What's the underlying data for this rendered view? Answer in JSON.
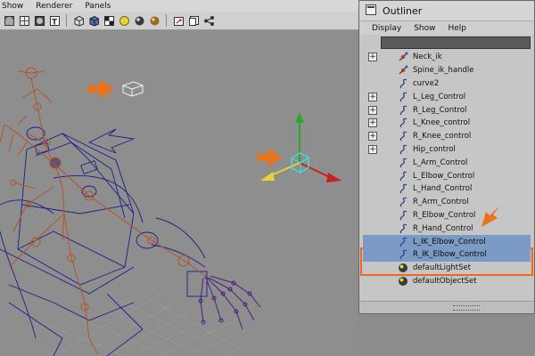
{
  "viewport": {
    "menu": [
      "Show",
      "Renderer",
      "Panels"
    ],
    "toolbar_icons": [
      "view-cube-icon",
      "wireframe-icon",
      "smooth-shade-icon",
      "textured-icon",
      "bounding-box-icon",
      "use-lights-icon",
      "shadows-icon",
      "ambient-occlusion-icon",
      "xray-icon",
      "isolate-icon",
      "camera-icon",
      "snapshot-icon"
    ]
  },
  "outliner": {
    "title": "Outliner",
    "menu": [
      "Display",
      "Show",
      "Help"
    ],
    "items": [
      {
        "label": "Neck_ik",
        "icon": "ik-handle-icon",
        "expandable": true,
        "selected": false
      },
      {
        "label": "Spine_ik_handle",
        "icon": "ik-handle-icon",
        "expandable": false,
        "selected": false
      },
      {
        "label": "curve2",
        "icon": "curve-icon",
        "expandable": false,
        "selected": false
      },
      {
        "label": "L_Leg_Control",
        "icon": "curve-icon",
        "expandable": true,
        "selected": false
      },
      {
        "label": "R_Leg_Control",
        "icon": "curve-icon",
        "expandable": true,
        "selected": false
      },
      {
        "label": "L_Knee_control",
        "icon": "curve-icon",
        "expandable": true,
        "selected": false
      },
      {
        "label": "R_Knee_control",
        "icon": "curve-icon",
        "expandable": true,
        "selected": false
      },
      {
        "label": "Hip_control",
        "icon": "curve-icon",
        "expandable": true,
        "selected": false
      },
      {
        "label": "L_Arm_Control",
        "icon": "curve-icon",
        "expandable": false,
        "selected": false
      },
      {
        "label": "L_Elbow_Control",
        "icon": "curve-icon",
        "expandable": false,
        "selected": false
      },
      {
        "label": "L_Hand_Control",
        "icon": "curve-icon",
        "expandable": false,
        "selected": false
      },
      {
        "label": "R_Arm_Control",
        "icon": "curve-icon",
        "expandable": false,
        "selected": false
      },
      {
        "label": "R_Elbow_Control",
        "icon": "curve-icon",
        "expandable": false,
        "selected": false
      },
      {
        "label": "R_Hand_Control",
        "icon": "curve-icon",
        "expandable": false,
        "selected": false
      },
      {
        "label": "L_IK_Elbow_Control",
        "icon": "curve-icon",
        "expandable": false,
        "selected": true
      },
      {
        "label": "R_IK_Elbow_Control",
        "icon": "curve-icon",
        "expandable": false,
        "selected": true
      },
      {
        "label": "defaultLightSet",
        "icon": "set-icon",
        "expandable": false,
        "selected": false
      },
      {
        "label": "defaultObjectSet",
        "icon": "set-icon",
        "expandable": false,
        "selected": false
      }
    ]
  },
  "colors": {
    "accent": "#e86a1b",
    "selection": "#7b9ac4",
    "skeleton": "#b5532a",
    "wireframe": "#1c1c8a"
  }
}
